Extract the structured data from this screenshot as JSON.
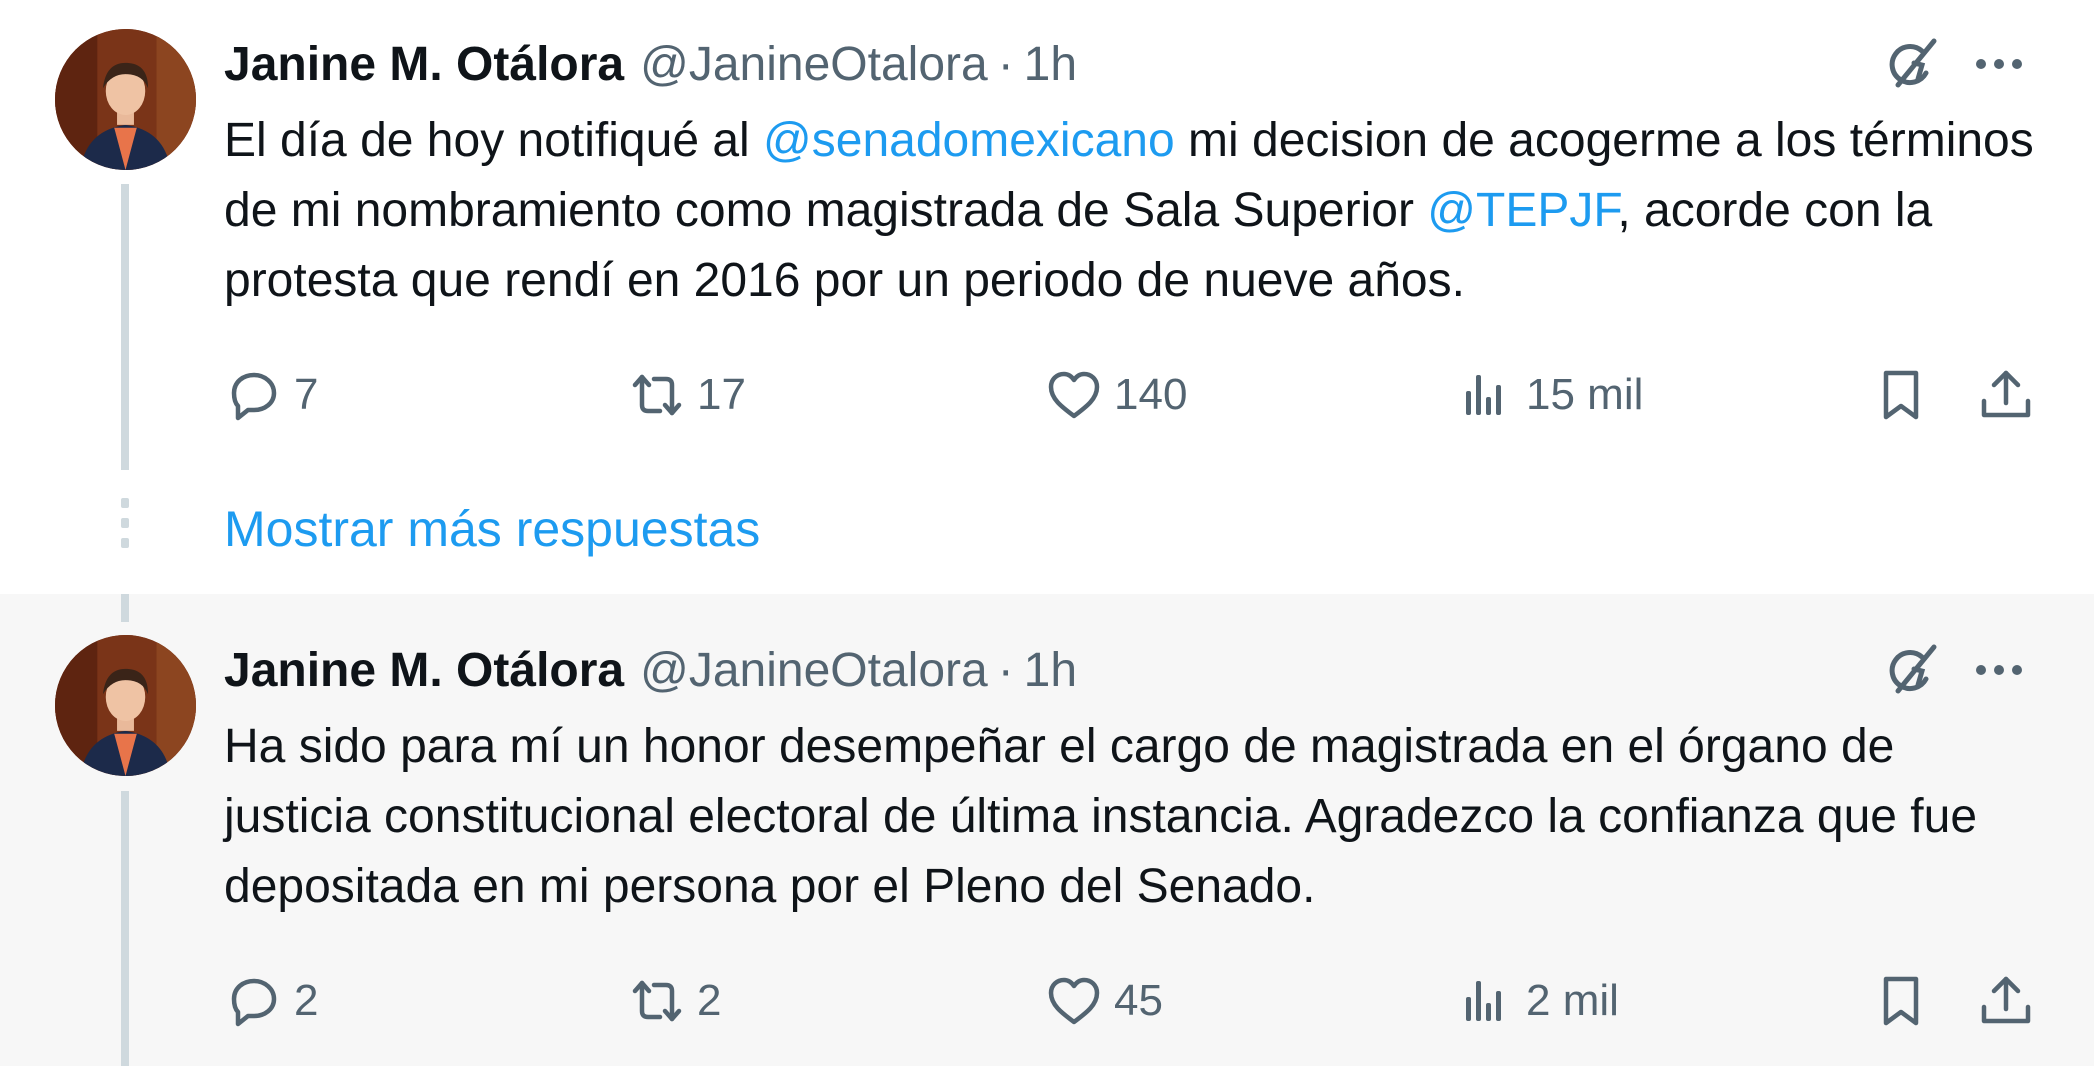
{
  "tweets": [
    {
      "author": {
        "name": "Janine M. Otálora",
        "handle": "@JanineOtalora"
      },
      "separator": "·",
      "time": "1h",
      "text_segments": [
        "El día de hoy notifiqué al ",
        "@senadomexicano",
        " mi decision de acogerme a los términos de mi nombramiento como magistrada de Sala Superior ",
        "@TEPJF",
        ", acorde con la protesta que rendí en 2016 por un periodo de nueve años."
      ],
      "stats": {
        "replies": "7",
        "reposts": "17",
        "likes": "140",
        "views": "15 mil"
      }
    },
    {
      "author": {
        "name": "Janine M. Otálora",
        "handle": "@JanineOtalora"
      },
      "separator": "·",
      "time": "1h",
      "text": "Ha sido para mí un honor desempeñar el cargo de magistrada en el órgano de justicia constitucional electoral de última instancia. Agradezco la confianza que fue depositada en mi persona por el Pleno del Senado.",
      "stats": {
        "replies": "2",
        "reposts": "2",
        "likes": "45",
        "views": "2 mil"
      }
    }
  ],
  "show_more_replies": "Mostrar más respuestas",
  "icons": [
    "avatar",
    "grok-icon",
    "more-icon",
    "reply-icon",
    "repost-icon",
    "like-icon",
    "views-icon",
    "bookmark-icon",
    "share-icon"
  ],
  "colors": {
    "link": "#1d9bf0",
    "secondary_text": "#536471",
    "thread_line": "#cfd9de",
    "second_tweet_bg": "#f7f7f7"
  }
}
